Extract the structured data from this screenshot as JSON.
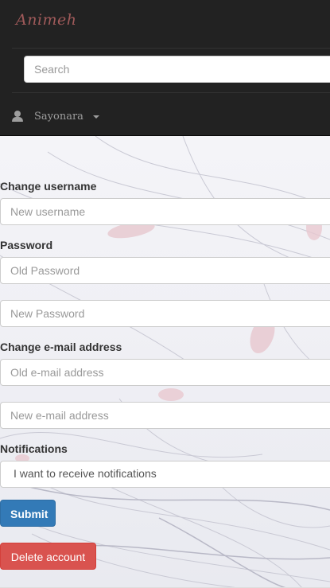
{
  "navbar": {
    "brand": "Animeh",
    "search": {
      "placeholder": "Search",
      "value": ""
    },
    "user": {
      "name": "Sayonara",
      "icon": "user-icon",
      "dropdown_icon": "caret-down-icon"
    }
  },
  "form": {
    "username": {
      "label": "Change username",
      "placeholder": "New username"
    },
    "password": {
      "label": "Password",
      "old_placeholder": "Old Password",
      "new_placeholder": "New Password"
    },
    "email": {
      "label": "Change e-mail address",
      "old_placeholder": "Old e-mail address",
      "new_placeholder": "New e-mail address"
    },
    "notifications": {
      "label": "Notifications",
      "selected": "I want to receive notifications"
    },
    "submit_label": "Submit",
    "delete_label": "Delete account"
  },
  "colors": {
    "navbar_bg": "#222222",
    "brand": "#a05a5a",
    "submit": "#337ab7",
    "delete": "#d9534f"
  }
}
